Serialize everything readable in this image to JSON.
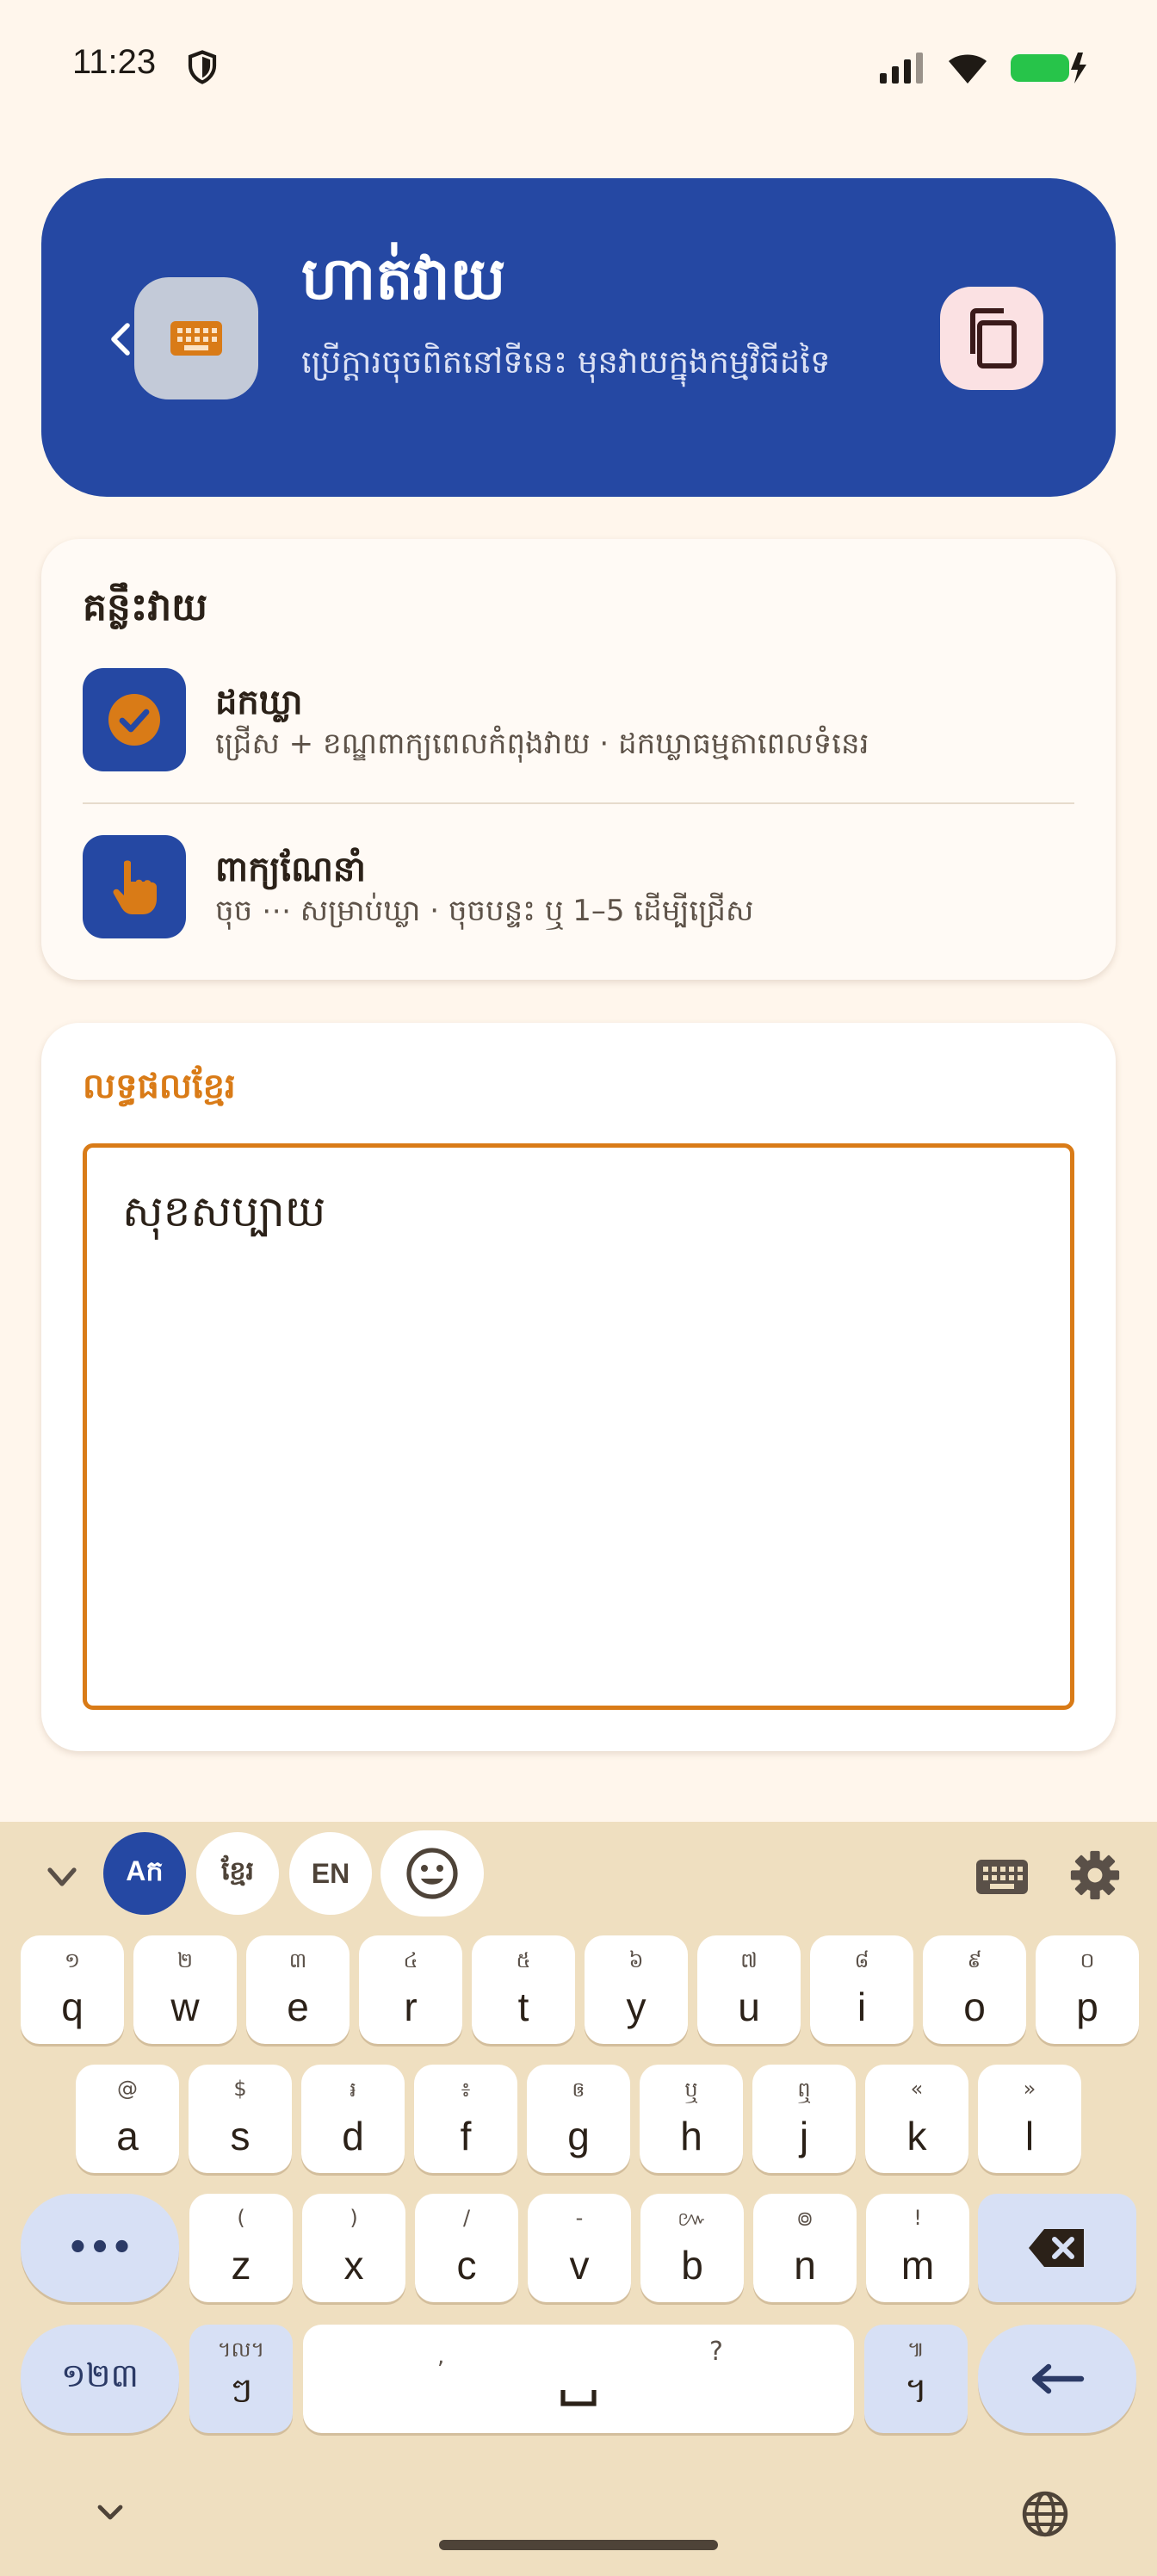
{
  "status_bar": {
    "time": "11:23",
    "shield_icon": "shield-icon",
    "signal_icon": "cell-signal-icon",
    "wifi_icon": "wifi-icon",
    "battery_icon": "battery-charging-icon",
    "battery_color": "#27c44a"
  },
  "header": {
    "title": "ហាត់វាយ",
    "subtitle": "ប្រើក្តារចុចពិតនៅទីនេះ មុនវាយក្នុងកម្មវិធីដទៃ",
    "back_icon": "chevron-left-icon",
    "keyboard_icon": "keyboard-icon",
    "copy_icon": "copy-icon",
    "bg_color": "#2548a3"
  },
  "keys_card": {
    "title": "គន្លឹះវាយ",
    "items": [
      {
        "title": "ដកឃ្លា",
        "description": "ជ្រើស + ខណ្ឌពាក្យពេលកំពុងវាយ · ដកឃ្លាធម្មតាពេលទំនេរ",
        "icon": "check-circle-icon"
      },
      {
        "title": "ពាក្យណែនាំ",
        "description": "ចុច ⋯ សម្រាប់ឃ្លា · ចុចបន្ទះ ឬ 1–5 ដើម្បីជ្រើស",
        "icon": "touch-icon"
      }
    ]
  },
  "result_card": {
    "label": "លទ្ធផលខ្មែរ",
    "text": "សុខសប្បាយ",
    "accent_color": "#d97b17"
  },
  "keyboard": {
    "modes": [
      {
        "label": "Aក",
        "active": true
      },
      {
        "label": "ខ្មែរ",
        "active": false
      },
      {
        "label": "EN",
        "active": false
      }
    ],
    "emoji_icon": "emoji-icon",
    "keyboard_icon": "keyboard-icon",
    "settings_icon": "gear-icon",
    "collapse_icon": "chevron-down-icon",
    "row1": [
      {
        "hint": "១",
        "label": "q"
      },
      {
        "hint": "២",
        "label": "w"
      },
      {
        "hint": "៣",
        "label": "e"
      },
      {
        "hint": "៤",
        "label": "r"
      },
      {
        "hint": "៥",
        "label": "t"
      },
      {
        "hint": "៦",
        "label": "y"
      },
      {
        "hint": "៧",
        "label": "u"
      },
      {
        "hint": "៨",
        "label": "i"
      },
      {
        "hint": "៩",
        "label": "o"
      },
      {
        "hint": "០",
        "label": "p"
      }
    ],
    "row2": [
      {
        "hint": "@",
        "label": "a"
      },
      {
        "hint": "$",
        "label": "s"
      },
      {
        "hint": "៛",
        "label": "d"
      },
      {
        "hint": "៖",
        "label": "f"
      },
      {
        "hint": "ឲ",
        "label": "g"
      },
      {
        "hint": "ឬ",
        "label": "h"
      },
      {
        "hint": "ឮ",
        "label": "j"
      },
      {
        "hint": "«",
        "label": "k"
      },
      {
        "hint": "»",
        "label": "l"
      }
    ],
    "row3": [
      {
        "hint": "(",
        "label": "z"
      },
      {
        "hint": ")",
        "label": "x"
      },
      {
        "hint": "/",
        "label": "c"
      },
      {
        "hint": "-",
        "label": "v"
      },
      {
        "hint": "៚",
        "label": "b"
      },
      {
        "hint": "៙",
        "label": "n"
      },
      {
        "hint": "!",
        "label": "m"
      }
    ],
    "more_label": "•••",
    "backspace_icon": "backspace-icon",
    "numbers_label": "១២៣",
    "khmer_repeat": {
      "hint": "។ល។",
      "label": "ៗ"
    },
    "space": {
      "hint_left": ",",
      "hint_right": "?",
      "label": "␣"
    },
    "khan": {
      "hint": "៕",
      "label": "។"
    },
    "enter_icon": "enter-icon"
  },
  "navigation": {
    "chevron_icon": "chevron-down-icon",
    "globe_icon": "globe-icon"
  }
}
